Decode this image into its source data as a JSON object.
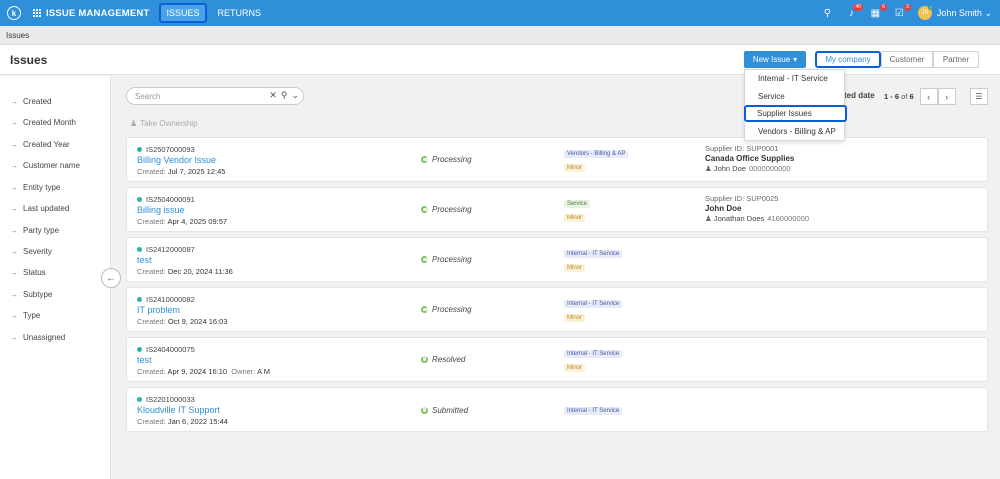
{
  "topbar": {
    "logo_letter": "k",
    "app_title": "ISSUE MANAGEMENT",
    "tabs": [
      {
        "label": "ISSUES",
        "active": true
      },
      {
        "label": "RETURNS",
        "active": false
      }
    ],
    "notifications_badge": "40",
    "tasks_badge": "6",
    "approvals_badge": "3",
    "avatar_initials": "JS",
    "user_name": "John Smith",
    "accent_color": "#2f8fd8"
  },
  "breadcrumb": "Issues",
  "header": {
    "title": "Issues",
    "new_issue_label": "New Issue",
    "segments": [
      "My company",
      "Customer",
      "Partner"
    ]
  },
  "new_issue_menu": [
    "Internal - IT Service",
    "Service",
    "Supplier Issues",
    "Vendors - Billing & AP"
  ],
  "sidebar": {
    "items": [
      "Created",
      "Created Month",
      "Created Year",
      "Customer name",
      "Entity type",
      "Last updated",
      "Party type",
      "Severity",
      "Status",
      "Subtype",
      "Type",
      "Unassigned"
    ]
  },
  "search": {
    "placeholder": "Search",
    "value": ""
  },
  "take_ownership": "Take Ownership",
  "sort_label": "ted date",
  "pager": {
    "range": "1 - 6",
    "of": "of",
    "total": "6"
  },
  "issues": [
    {
      "id": "IS2507000093",
      "title": "Billing Vendor Issue",
      "created_label": "Created:",
      "created": "Jul 7, 2025 12:45",
      "status": "Processing",
      "category": "Vendors - Billing & AP",
      "severity": "Minor",
      "supplier_label": "Supplier ID:",
      "supplier_id": "SUP0001",
      "supplier_name": "Canada Office Supplies",
      "contact": "John Doe",
      "phone": "0000000000"
    },
    {
      "id": "IS2504000091",
      "title": "Billing issue",
      "created_label": "Created:",
      "created": "Apr 4, 2025 09:57",
      "status": "Processing",
      "category": "Service",
      "severity": "Minor",
      "supplier_label": "Supplier ID:",
      "supplier_id": "SUP0025",
      "supplier_name": "John Doe",
      "contact": "Jonathan Does",
      "phone": "4160000000"
    },
    {
      "id": "IS2412000087",
      "title": "test",
      "created_label": "Created:",
      "created": "Dec 20, 2024 11:36",
      "status": "Processing",
      "category": "Internal - IT Service",
      "severity": "Minor"
    },
    {
      "id": "IS2410000082",
      "title": "IT problem",
      "created_label": "Created:",
      "created": "Oct 9, 2024 16:03",
      "status": "Processing",
      "category": "Internal - IT Service",
      "severity": "Minor"
    },
    {
      "id": "IS2404000075",
      "title": "test",
      "created_label": "Created:",
      "created": "Apr 9, 2024 16:10",
      "owner_label": "Owner:",
      "owner": "A M",
      "status": "Resolved",
      "category": "Internal - IT Service",
      "severity": "Minor"
    },
    {
      "id": "IS2201000033",
      "title": "Kloudville IT Support",
      "created_label": "Created:",
      "created": "Jan 6, 2022 15:44",
      "status": "Submitted",
      "category": "Internal - IT Service"
    }
  ]
}
